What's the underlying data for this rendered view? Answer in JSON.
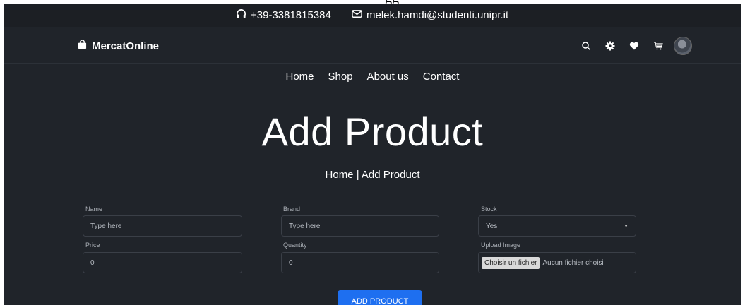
{
  "topbar": {
    "phone": "+39-3381815384",
    "email": "melek.hamdi@studenti.unipr.it",
    "phone_icon": "headphones-icon",
    "email_icon": "envelope-icon"
  },
  "header": {
    "brand": "MercatOnline",
    "brand_icon": "shopping-bag-icon",
    "icons": [
      "search-icon",
      "gear-icon",
      "heart-icon",
      "cart-icon",
      "avatar"
    ]
  },
  "nav": {
    "items": [
      {
        "label": "Home"
      },
      {
        "label": "Shop"
      },
      {
        "label": "About us"
      },
      {
        "label": "Contact"
      }
    ]
  },
  "hero": {
    "title": "Add Product",
    "breadcrumb": "Home | Add Product"
  },
  "form": {
    "name": {
      "label": "Name",
      "placeholder": "Type here"
    },
    "brand": {
      "label": "Brand",
      "placeholder": "Type here"
    },
    "stock": {
      "label": "Stock",
      "value": "Yes"
    },
    "price": {
      "label": "Price",
      "value": "0"
    },
    "quantity": {
      "label": "Quantity",
      "value": "0"
    },
    "upload": {
      "label": "Upload Image",
      "button": "Choisir un fichier",
      "status": "Aucun fichier choisi"
    },
    "submit": "ADD PRODUCT"
  },
  "colors": {
    "background": "#20242a",
    "topbar": "#1c1f24",
    "accent": "#1e6ff0"
  }
}
